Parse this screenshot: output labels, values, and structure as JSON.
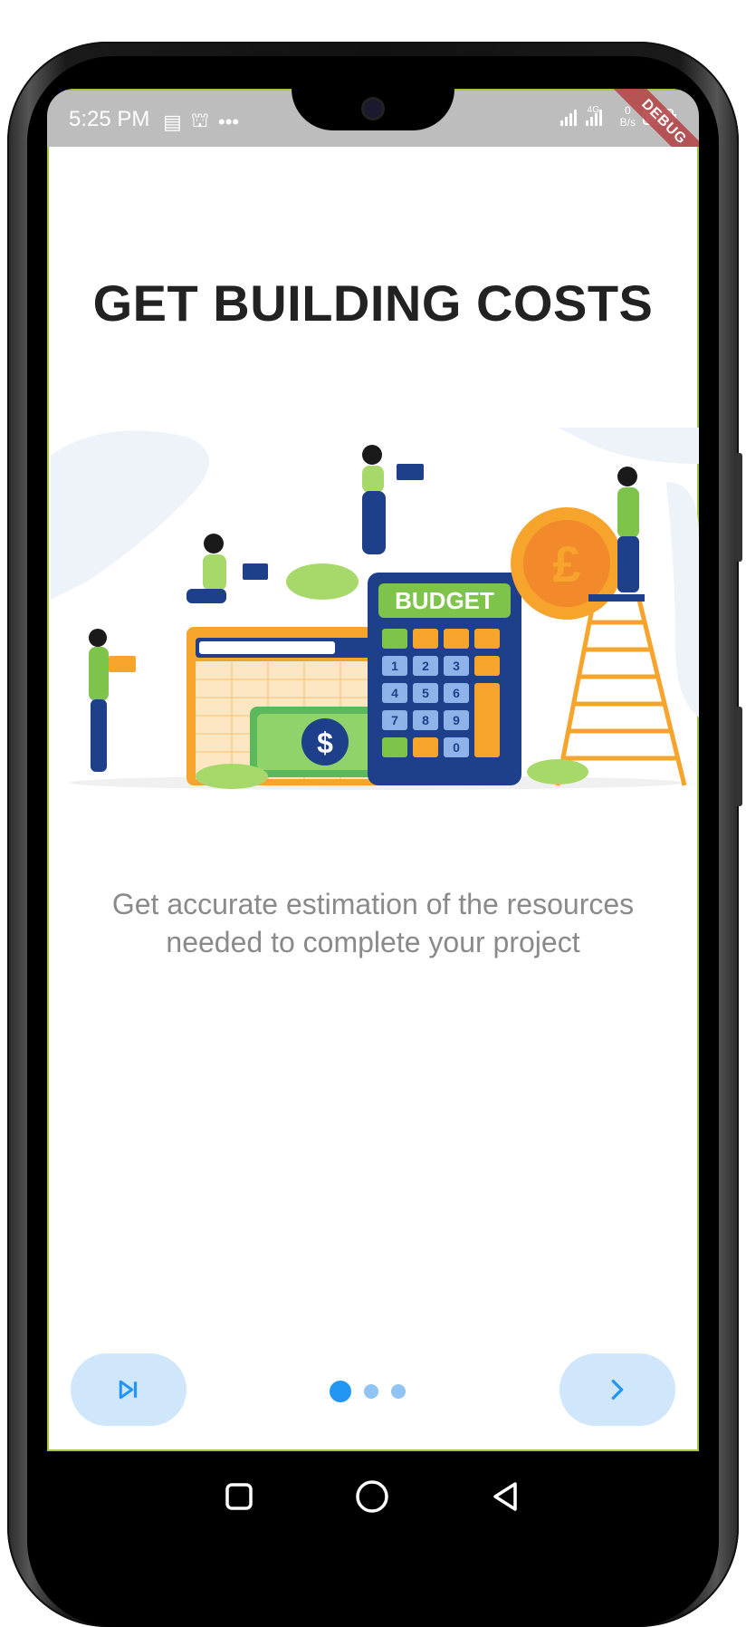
{
  "status_bar": {
    "time": "5:25 PM",
    "network_label": "4G",
    "speed_value": "0",
    "speed_unit": "B/s"
  },
  "debug_banner": "DEBUG",
  "onboarding": {
    "title": "GET BUILDING COSTS",
    "description": "Get accurate estimation of the resources needed to complete your project",
    "page_indicator": {
      "pages": 3,
      "current": 1
    }
  },
  "illustration": {
    "budget_label": "BUDGET",
    "keypad": [
      "1",
      "2",
      "3",
      "4",
      "5",
      "6",
      "7",
      "8",
      "9",
      "0"
    ],
    "currency_symbol": "$",
    "pound_symbol": "£"
  },
  "icons": {
    "skip": "skip-next-icon",
    "next": "chevron-right-icon",
    "nav_recents": "square-icon",
    "nav_home": "circle-icon",
    "nav_back": "triangle-back-icon"
  },
  "colors": {
    "accent": "#2196f3",
    "button_bg": "#cfe6fb",
    "title": "#222222",
    "description": "#8a8a8a",
    "status_bar": "#bdbdbd",
    "debug_banner": "#b5474a"
  }
}
